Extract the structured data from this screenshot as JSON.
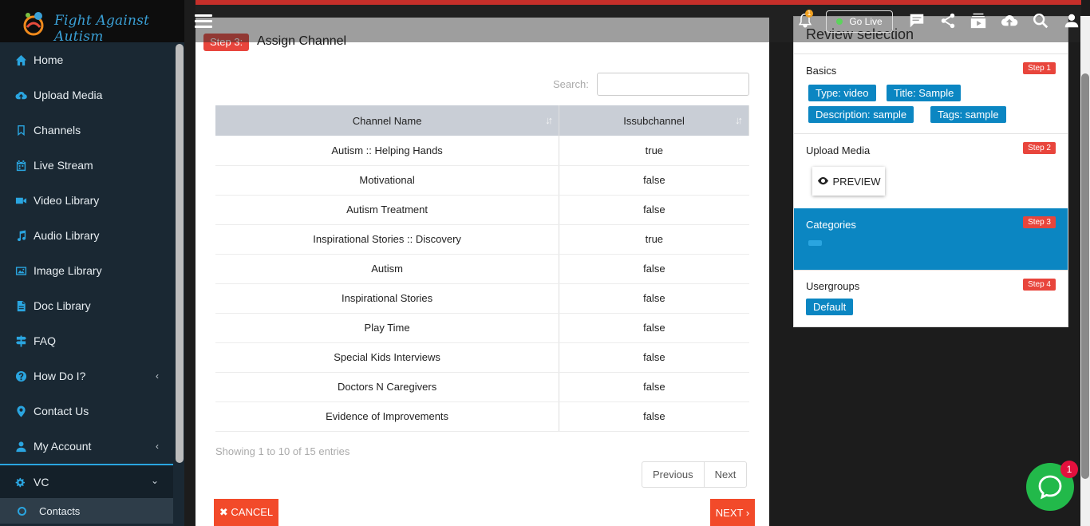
{
  "brand": {
    "name": "Fight Against Autism"
  },
  "sidebar": {
    "items": [
      {
        "label": "Home",
        "icon": "home-icon"
      },
      {
        "label": "Upload Media",
        "icon": "cloud-upload-icon"
      },
      {
        "label": "Channels",
        "icon": "bookmark-icon"
      },
      {
        "label": "Live Stream",
        "icon": "calendar-icon"
      },
      {
        "label": "Video Library",
        "icon": "video-camera-icon"
      },
      {
        "label": "Audio Library",
        "icon": "music-icon"
      },
      {
        "label": "Image Library",
        "icon": "image-icon"
      },
      {
        "label": "Doc Library",
        "icon": "document-icon"
      },
      {
        "label": "FAQ",
        "icon": "signpost-icon"
      },
      {
        "label": "How Do I?",
        "icon": "question-icon"
      },
      {
        "label": "Contact Us",
        "icon": "location-pin-icon"
      },
      {
        "label": "My Account",
        "icon": "user-icon"
      },
      {
        "label": "VC",
        "icon": "cogs-icon"
      }
    ],
    "subitem": {
      "label": "Contacts"
    }
  },
  "topbar": {
    "notification_count": "1",
    "golive_label": "Go Live"
  },
  "main": {
    "step_label": "Step 3:",
    "title": "Assign Channel",
    "search_label": "Search:",
    "columns": [
      "Channel Name",
      "Issubchannel"
    ],
    "rows": [
      [
        "Autism :: Helping Hands",
        "true"
      ],
      [
        "Motivational",
        "false"
      ],
      [
        "Autism Treatment",
        "false"
      ],
      [
        "Inspirational Stories :: Discovery",
        "true"
      ],
      [
        "Autism",
        "false"
      ],
      [
        "Inspirational Stories",
        "false"
      ],
      [
        "Play Time",
        "false"
      ],
      [
        "Special Kids Interviews",
        "false"
      ],
      [
        "Doctors N Caregivers",
        "false"
      ],
      [
        "Evidence of Improvements",
        "false"
      ]
    ],
    "entries_info": "Showing 1 to 10 of 15 entries",
    "pager": {
      "previous": "Previous",
      "next": "Next"
    },
    "cancel_label": "✖ CANCEL",
    "next_label": "NEXT ›"
  },
  "review": {
    "title": "Review selection",
    "basics": {
      "label": "Basics",
      "step": "Step 1",
      "tags": [
        "Type: video",
        "Title: Sample",
        "Description: sample",
        "Tags: sample"
      ]
    },
    "upload": {
      "label": "Upload Media",
      "step": "Step 2",
      "preview_label": "PREVIEW"
    },
    "categories": {
      "label": "Categories",
      "step": "Step 3"
    },
    "usergroups": {
      "label": "Usergroups",
      "step": "Step 4",
      "tags": [
        "Default"
      ]
    }
  },
  "chat": {
    "badge": "1"
  },
  "colors": {
    "accent": "#0b86c2",
    "danger": "#e8453c",
    "sidebar": "#1a2833",
    "chat": "#22b94a"
  }
}
